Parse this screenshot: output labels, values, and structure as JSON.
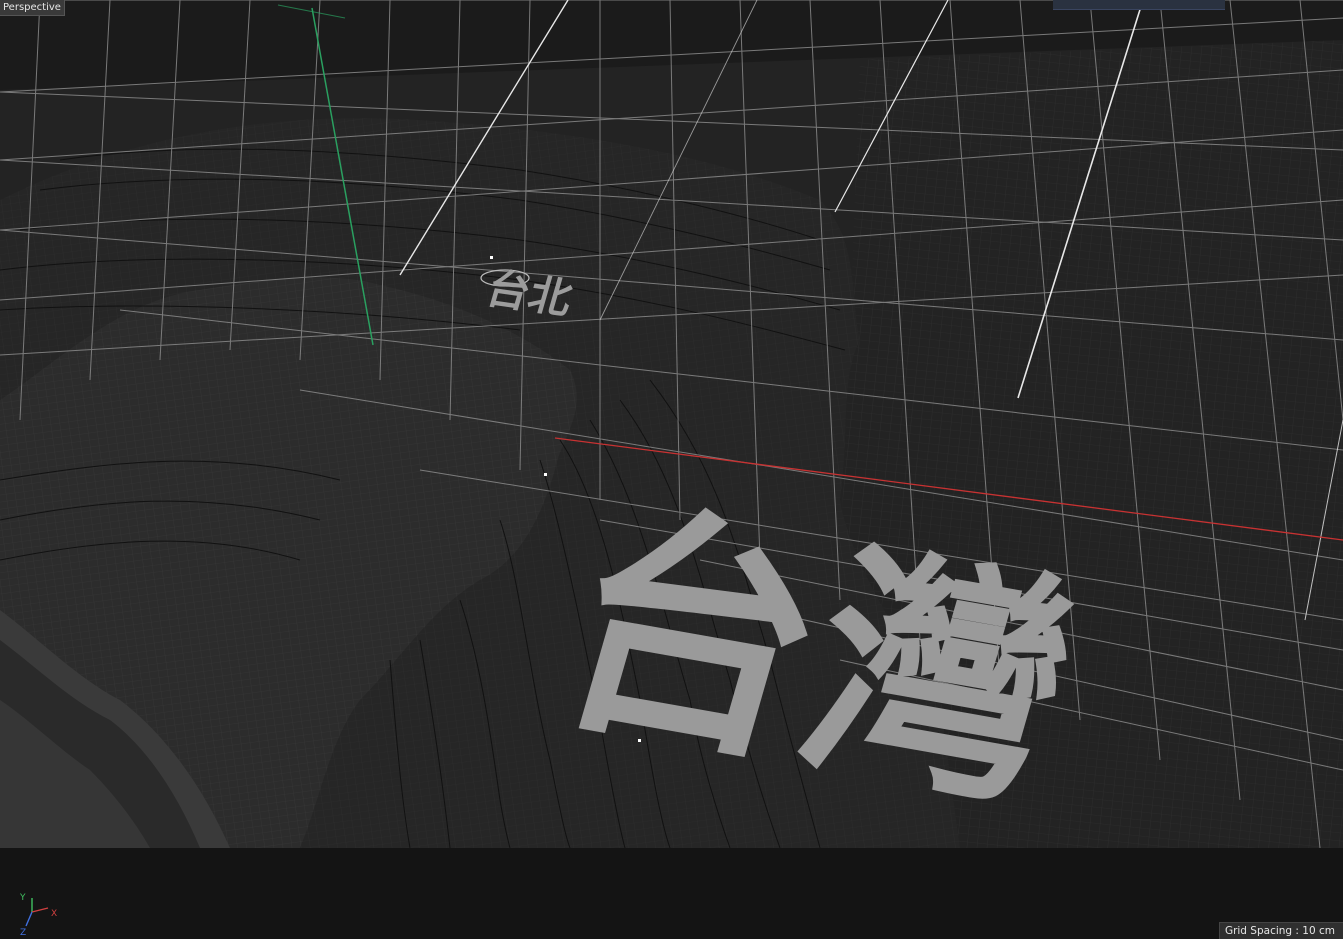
{
  "viewport": {
    "view_name": "Perspective",
    "grid_spacing_label": "Grid Spacing : 10 cm"
  },
  "scene": {
    "label_small": "台北",
    "label_large": "台灣"
  },
  "axis_gizmo": {
    "x_label": "X",
    "y_label": "Y",
    "z_label": "Z",
    "x_color": "#d04040",
    "y_color": "#40c060",
    "z_color": "#4070e0"
  },
  "colors": {
    "background": "#1b1b1b",
    "grid": "#9a9a9a",
    "terrain_dark": "#242424",
    "text_mesh": "#9c9c9c",
    "x_axis_line": "#c83232",
    "y_axis_line": "#2aa060"
  }
}
